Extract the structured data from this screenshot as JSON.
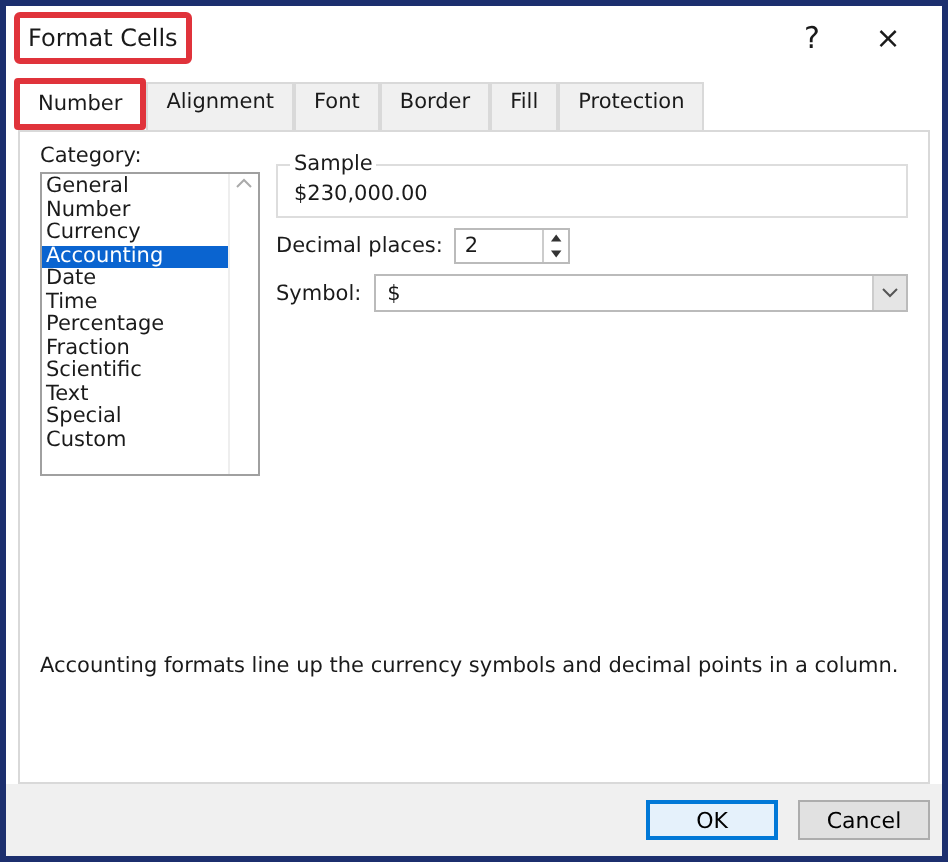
{
  "window": {
    "title": "Format Cells",
    "title_highlighted": true,
    "help": "?",
    "close": "×"
  },
  "tabs": [
    {
      "label": "Number",
      "selected": true,
      "highlighted": true
    },
    {
      "label": "Alignment",
      "selected": false,
      "highlighted": false
    },
    {
      "label": "Font",
      "selected": false,
      "highlighted": false
    },
    {
      "label": "Border",
      "selected": false,
      "highlighted": false
    },
    {
      "label": "Fill",
      "selected": false,
      "highlighted": false
    },
    {
      "label": "Protection",
      "selected": false,
      "highlighted": false
    }
  ],
  "category": {
    "label": "Category:",
    "items": [
      {
        "label": "General",
        "selected": false
      },
      {
        "label": "Number",
        "selected": false
      },
      {
        "label": "Currency",
        "selected": false
      },
      {
        "label": "Accounting",
        "selected": true
      },
      {
        "label": "Date",
        "selected": false
      },
      {
        "label": "Time",
        "selected": false
      },
      {
        "label": "Percentage",
        "selected": false
      },
      {
        "label": "Fraction",
        "selected": false
      },
      {
        "label": "Scientific",
        "selected": false
      },
      {
        "label": "Text",
        "selected": false
      },
      {
        "label": "Special",
        "selected": false
      },
      {
        "label": "Custom",
        "selected": false
      }
    ]
  },
  "sample": {
    "label": "Sample",
    "value": "$230,000.00"
  },
  "decimal_places": {
    "label": "Decimal places:",
    "value": "2"
  },
  "symbol": {
    "label": "Symbol:",
    "value": "$"
  },
  "description": "Accounting formats line up the currency symbols and decimal points in a column.",
  "buttons": [
    {
      "label": "OK",
      "default": true
    },
    {
      "label": "Cancel",
      "default": false
    }
  ]
}
